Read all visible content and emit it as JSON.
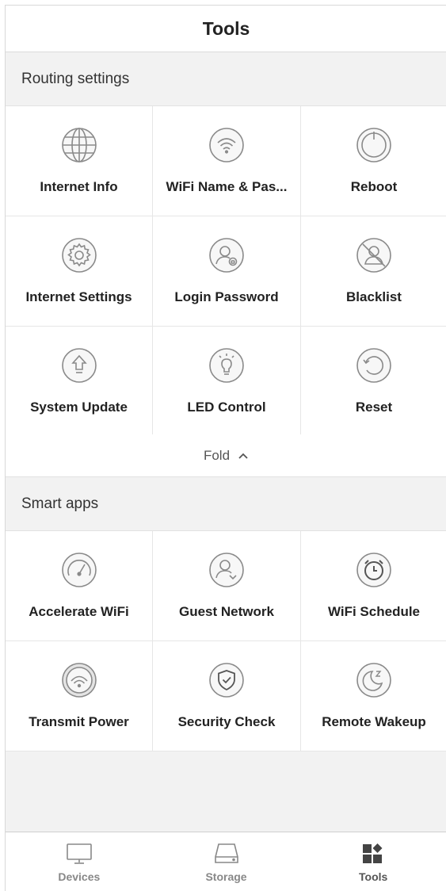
{
  "header": {
    "title": "Tools"
  },
  "routing": {
    "title": "Routing settings",
    "items": [
      {
        "label": "Internet Info",
        "icon": "globe-icon"
      },
      {
        "label": "WiFi Name & Pas...",
        "icon": "wifi-icon"
      },
      {
        "label": "Reboot",
        "icon": "power-icon"
      },
      {
        "label": "Internet Settings",
        "icon": "gear-icon"
      },
      {
        "label": "Login Password",
        "icon": "user-lock-icon"
      },
      {
        "label": "Blacklist",
        "icon": "blocked-user-icon"
      },
      {
        "label": "System Update",
        "icon": "upgrade-arrow-icon"
      },
      {
        "label": "LED Control",
        "icon": "light-bulb-icon"
      },
      {
        "label": "Reset",
        "icon": "reset-icon"
      }
    ],
    "fold_label": "Fold"
  },
  "smart": {
    "title": "Smart apps",
    "items": [
      {
        "label": "Accelerate WiFi",
        "icon": "speedometer-icon"
      },
      {
        "label": "Guest Network",
        "icon": "guest-user-icon"
      },
      {
        "label": "WiFi Schedule",
        "icon": "alarm-clock-icon"
      },
      {
        "label": "Transmit Power",
        "icon": "wifi-signal-icon"
      },
      {
        "label": "Security Check",
        "icon": "shield-check-icon"
      },
      {
        "label": "Remote Wakeup",
        "icon": "moon-icon"
      }
    ]
  },
  "tabbar": {
    "tabs": [
      {
        "label": "Devices",
        "icon": "monitor-icon",
        "active": false
      },
      {
        "label": "Storage",
        "icon": "storage-drive-icon",
        "active": false
      },
      {
        "label": "Tools",
        "icon": "tools-grid-icon",
        "active": true
      }
    ]
  },
  "colors": {
    "background": "#f2f2f2",
    "icon_stroke": "#8a8a8a",
    "text": "#222222"
  }
}
